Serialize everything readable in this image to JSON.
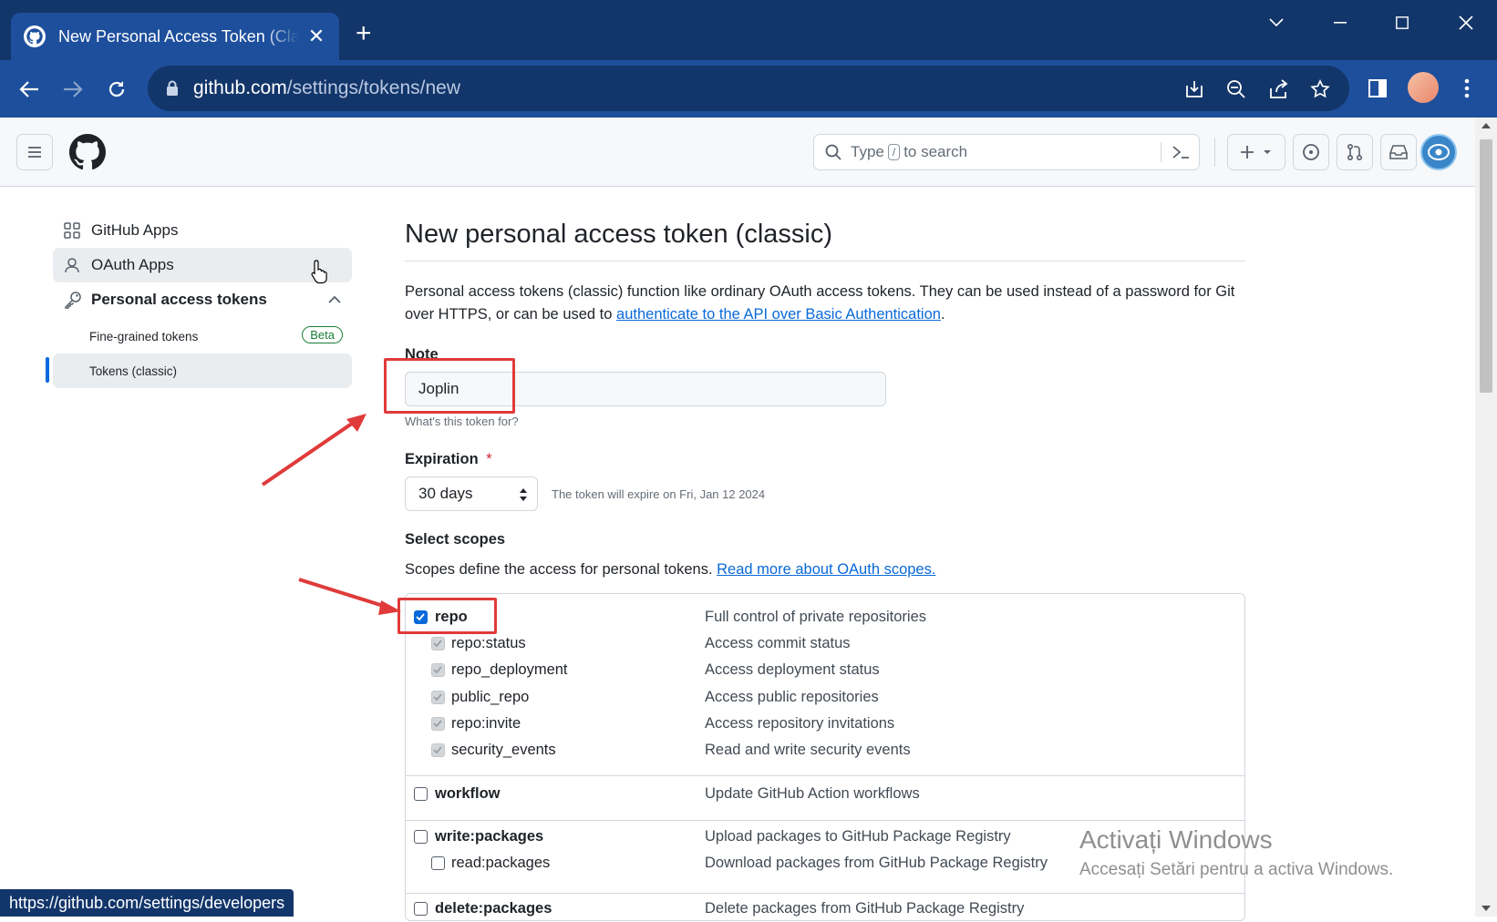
{
  "browser": {
    "tab_title": "New Personal Access Token (Classic)",
    "url_host": "github.com",
    "url_path": "/settings/tokens/new",
    "status_url": "https://github.com/settings/developers"
  },
  "header": {
    "search_prefix": "Type",
    "search_key": "/",
    "search_suffix": "to search"
  },
  "sidebar": {
    "items": [
      {
        "label": "GitHub Apps",
        "icon": "apps-icon"
      },
      {
        "label": "OAuth Apps",
        "icon": "person-icon"
      },
      {
        "label": "Personal access tokens",
        "icon": "key-icon"
      }
    ],
    "sub_items": [
      {
        "label": "Fine-grained tokens",
        "badge": "Beta"
      },
      {
        "label": "Tokens (classic)",
        "selected": true
      }
    ]
  },
  "main": {
    "title": "New personal access token (classic)",
    "description_text": "Personal access tokens (classic) function like ordinary OAuth access tokens. They can be used instead of a password for Git over HTTPS, or can be used to",
    "description_link": "authenticate to the API over Basic Authentication",
    "description_end": ".",
    "note_label": "Note",
    "note_value": "Joplin",
    "note_hint": "What's this token for?",
    "expiration_label": "Expiration",
    "required_mark": "*",
    "expiration_value": "30 days",
    "expiration_hint": "The token will expire on Fri, Jan 12 2024",
    "scopes_label": "Select scopes",
    "scopes_text": "Scopes define the access for personal tokens.",
    "scopes_link": "Read more about OAuth scopes.",
    "scopes": [
      {
        "name": "repo",
        "desc": "Full control of private repositories",
        "checked": true,
        "parent": true
      },
      {
        "name": "repo:status",
        "desc": "Access commit status",
        "checked": true,
        "disabled": true
      },
      {
        "name": "repo_deployment",
        "desc": "Access deployment status",
        "checked": true,
        "disabled": true
      },
      {
        "name": "public_repo",
        "desc": "Access public repositories",
        "checked": true,
        "disabled": true
      },
      {
        "name": "repo:invite",
        "desc": "Access repository invitations",
        "checked": true,
        "disabled": true
      },
      {
        "name": "security_events",
        "desc": "Read and write security events",
        "checked": true,
        "disabled": true
      },
      {
        "name": "workflow",
        "desc": "Update GitHub Action workflows",
        "checked": false,
        "parent": true
      },
      {
        "name": "write:packages",
        "desc": "Upload packages to GitHub Package Registry",
        "checked": false,
        "parent": true
      },
      {
        "name": "read:packages",
        "desc": "Download packages from GitHub Package Registry",
        "checked": false
      },
      {
        "name": "delete:packages",
        "desc": "Delete packages from GitHub Package Registry",
        "checked": false,
        "parent": true
      }
    ]
  },
  "watermark": {
    "line1": "Activați Windows",
    "line2": "Accesați Setări pentru a activa Windows."
  },
  "colors": {
    "accent": "#0969da",
    "chrome_dark": "#13366a",
    "chrome": "#1d4f9c",
    "annotation_red": "#e03a3a",
    "beta_green": "#1a7f37"
  }
}
